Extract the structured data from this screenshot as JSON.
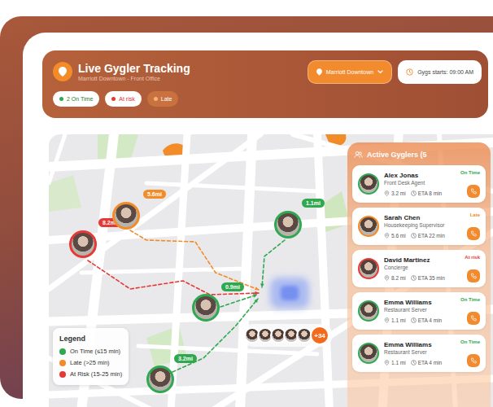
{
  "header": {
    "title": "Live Gygler Tracking",
    "subtitle": "Marriott Downtown - Front Office",
    "location": "Marriott Downtown",
    "start_time": "Gygs starts: 09:00 AM"
  },
  "filters": [
    {
      "label": "2 On Time",
      "color": "#2fa84f",
      "selected": false
    },
    {
      "label": "At risk",
      "color": "#e53935",
      "selected": false
    },
    {
      "label": "Late",
      "color": "#f7b27a",
      "selected": true
    }
  ],
  "map": {
    "pins": [
      {
        "label": "8.2mi",
        "color": "#e53935"
      },
      {
        "label": "5.6mi",
        "color": "#f28c28"
      },
      {
        "label": "1.1mi",
        "color": "#2fa84f"
      },
      {
        "label": "0.9mi",
        "color": "#2fa84f"
      },
      {
        "label": "3.2mi",
        "color": "#2fa84f"
      }
    ],
    "crowd": {
      "avatars": 5,
      "more": "+34"
    }
  },
  "legend": {
    "title": "Legend",
    "items": [
      {
        "label": "On Time (≤15 min)",
        "color": "#2fa84f"
      },
      {
        "label": "Late (>25 min)",
        "color": "#f28c28"
      },
      {
        "label": "At Risk (15-25 min)",
        "color": "#e53935"
      }
    ]
  },
  "panel": {
    "title": "Active Gyglers (5",
    "gyglers": [
      {
        "name": "Alex Jonas",
        "role": "Front Desk Agent",
        "status": "On Time",
        "color": "#2fa84f",
        "distance": "3.2 mi",
        "eta": "ETA 8 min"
      },
      {
        "name": "Sarah Chen",
        "role": "Housekeeping Supervisor",
        "status": "Late",
        "color": "#f28c28",
        "distance": "5.6 mi",
        "eta": "ETA 22 min"
      },
      {
        "name": "David Martinez",
        "role": "Concierge",
        "status": "At risk",
        "color": "#e53935",
        "distance": "8.2 mi",
        "eta": "ETA 35 min"
      },
      {
        "name": "Emma Williams",
        "role": "Restaurant Server",
        "status": "On Time",
        "color": "#2fa84f",
        "distance": "1.1 mi",
        "eta": "ETA 4 min"
      },
      {
        "name": "Emma Williams",
        "role": "Restaurant Server",
        "status": "On Time",
        "color": "#2fa84f",
        "distance": "1.1 mi",
        "eta": "ETA 4 min"
      }
    ]
  }
}
